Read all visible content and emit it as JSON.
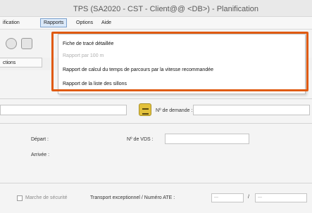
{
  "window": {
    "title": "TPS (SA2020 - CST - Client@@ <DB>) - Planification"
  },
  "menubar": {
    "items": [
      {
        "label": "ification"
      },
      {
        "label": "Rapports"
      },
      {
        "label": "Options"
      },
      {
        "label": "Aide"
      }
    ]
  },
  "tabs": {
    "label": "ctions"
  },
  "rapports_menu": {
    "items": [
      {
        "label": "Fiche de tracé détaillée",
        "enabled": true
      },
      {
        "label": "Rapport par 100 m",
        "enabled": false
      },
      {
        "label": "Rapport de calcul du temps de parcours par la vitesse recommandée",
        "enabled": true
      },
      {
        "label": "Rapport de la liste des sillons",
        "enabled": true
      }
    ]
  },
  "form": {
    "demande_label": "Nº de demande :",
    "depart_label": "Départ :",
    "arrivee_label": "Arrivée :",
    "vds_label": "Nº de VDS :",
    "security_label": "Marche de sécurité",
    "transport_label": "Transport exceptionnel / Numéro ATE :",
    "select_placeholder": "---",
    "separator": "/"
  },
  "colors": {
    "highlight": "#e05a10",
    "accent_button": "#e2c13c"
  }
}
